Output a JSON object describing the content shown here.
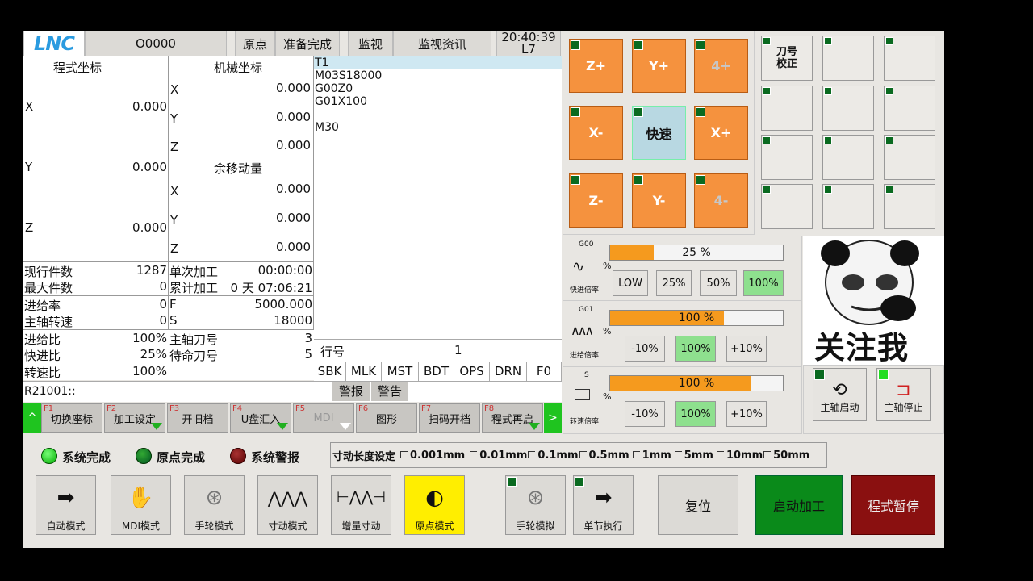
{
  "header": {
    "logo": "LNC",
    "program": "O0000",
    "origin": "原点",
    "ready": "准备完成",
    "monitor": "监视",
    "monitor_info": "监视资讯",
    "time": "20:40:39",
    "level": "L7"
  },
  "coords": {
    "title": "程式坐标",
    "x": "0.000",
    "y": "0.000",
    "z": "0.000",
    "X": "X",
    "Y": "Y",
    "Z": "Z"
  },
  "machine": {
    "title": "机械坐标",
    "x": "0.000",
    "y": "0.000",
    "z": "0.000"
  },
  "remain": {
    "title": "余移动量",
    "x": "0.000",
    "y": "0.000",
    "z": "0.000"
  },
  "stats": {
    "cur_count_l": "现行件数",
    "cur_count": "1287",
    "max_count_l": "最大件数",
    "max_count": "0",
    "single_l": "单次加工",
    "single": "00:00:00",
    "total_l": "累计加工",
    "total": "0 天 07:06:21",
    "feed_l": "进给率",
    "feed": "0",
    "spindle_l": "主轴转速",
    "spindle": "0",
    "F": "F",
    "F_val": "5000.000",
    "S": "S",
    "S_val": "18000",
    "feed_ratio_l": "进给比",
    "feed_ratio": "100%",
    "rapid_ratio_l": "快进比",
    "rapid_ratio": "25%",
    "speed_ratio_l": "转速比",
    "speed_ratio": "100%",
    "tool_l": "主轴刀号",
    "tool": "3",
    "wait_tool_l": "待命刀号",
    "wait_tool": "5"
  },
  "program": {
    "lines": [
      "T1",
      "M03S18000",
      "G00Z0",
      "G01X100",
      "",
      "M30"
    ],
    "line_label": "行号",
    "line_num": "1"
  },
  "status_flags": [
    "SBK",
    "MLK",
    "MST",
    "BDT",
    "OPS",
    "DRN",
    "F0"
  ],
  "message": {
    "code": "R21001::",
    "alarm": "警报",
    "warning": "警告"
  },
  "fkeys": [
    {
      "fn": "F1",
      "label": "切换座标"
    },
    {
      "fn": "F2",
      "label": "加工设定"
    },
    {
      "fn": "F3",
      "label": "开旧档"
    },
    {
      "fn": "F4",
      "label": "U盘汇入"
    },
    {
      "fn": "F5",
      "label": "MDI"
    },
    {
      "fn": "F6",
      "label": "图形"
    },
    {
      "fn": "F7",
      "label": "扫码开档"
    },
    {
      "fn": "F8",
      "label": "程式再启"
    }
  ],
  "fkeys_nav": {
    "prev": "^",
    "next": ">"
  },
  "jog": {
    "zp": "Z+",
    "yp": "Y+",
    "ap": "4+",
    "xm": "X-",
    "fast": "快速",
    "xp": "X+",
    "zm": "Z-",
    "ym": "Y-",
    "am": "4-"
  },
  "tool_check": "刀号\n校正",
  "rapid": {
    "code": "G00",
    "pct": "25 %",
    "fill": 25,
    "label": "快进倍率",
    "unit": "%",
    "opts": [
      "LOW",
      "25%",
      "50%",
      "100%"
    ]
  },
  "feedrate": {
    "code": "G01",
    "pct": "100 %",
    "fill": 66,
    "label": "进给倍率",
    "unit": "%",
    "opts": [
      "-10%",
      "100%",
      "+10%"
    ]
  },
  "spindle_rate": {
    "code": "S",
    "pct": "100 %",
    "fill": 82,
    "label": "转速倍率",
    "unit": "%",
    "opts": [
      "-10%",
      "100%",
      "+10%"
    ]
  },
  "meme_text": "关注我",
  "spindle_btns": {
    "start": "主轴启动",
    "stop": "主轴停止"
  },
  "lamps": {
    "sys_done": "系统完成",
    "home_done": "原点完成",
    "sys_alarm": "系统警报"
  },
  "jog_len": {
    "label": "寸动长度设定",
    "opts": [
      "0.001mm",
      "0.01mm",
      "0.1mm",
      "0.5mm",
      "1mm",
      "5mm",
      "10mm",
      "50mm"
    ]
  },
  "modes": {
    "auto": "自动模式",
    "mdi": "MDI模式",
    "hand": "手轮模式",
    "jog": "寸动模式",
    "inc": "增量寸动",
    "home": "原点模式",
    "hand_sim": "手轮模拟",
    "single": "单节执行"
  },
  "actions": {
    "reset": "复位",
    "start": "启动加工",
    "pause": "程式暂停"
  },
  "colors": {
    "orange": "#f5923e",
    "green_btn": "#0a8a1a",
    "red_btn": "#8a1010",
    "selected": "#8ee08e",
    "home_mode": "#ffee00"
  }
}
